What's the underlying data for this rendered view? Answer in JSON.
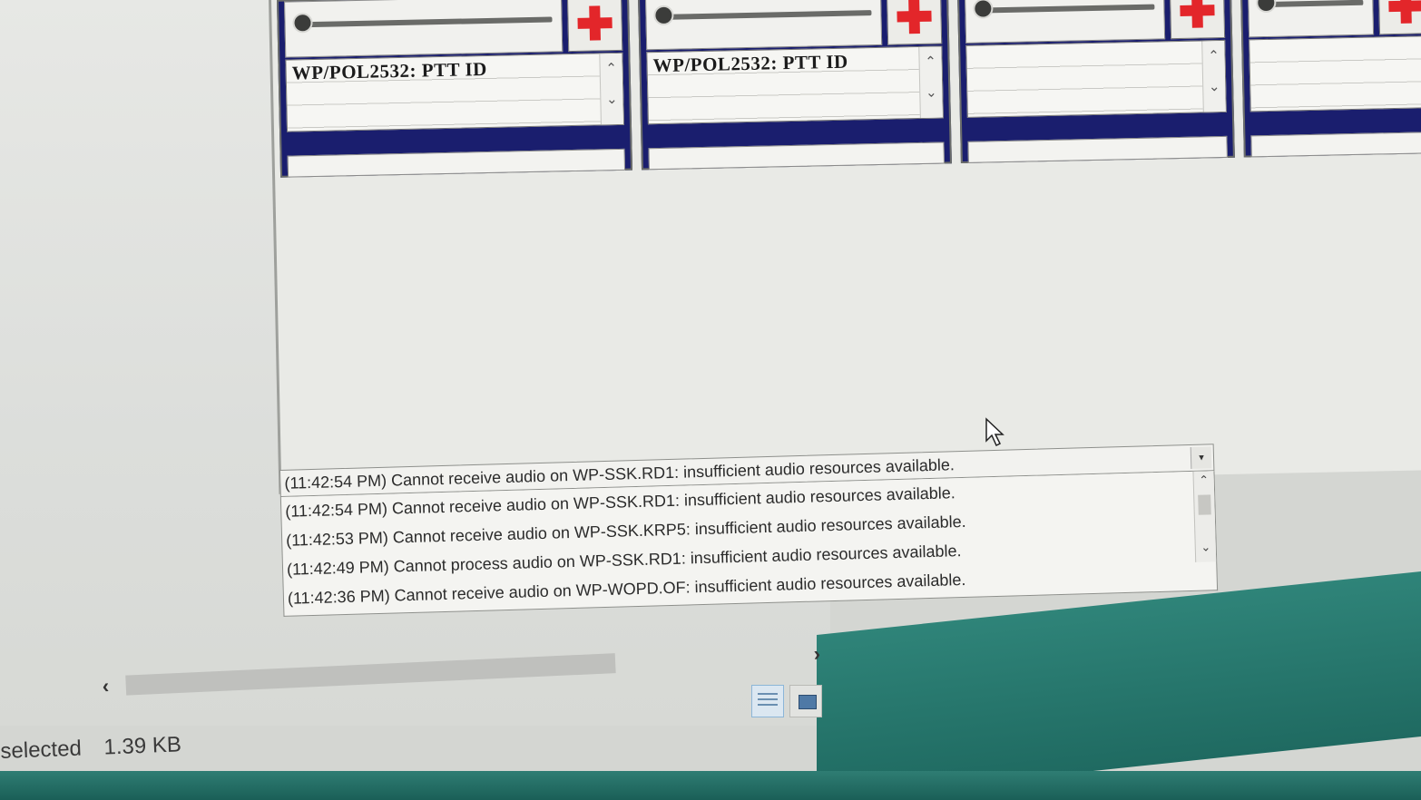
{
  "channel_panels": [
    {
      "id_label": "WP/POL2532: PTT ID"
    },
    {
      "id_label": "WP/POL2532: PTT ID"
    },
    {
      "id_label": ""
    },
    {
      "id_label": ""
    }
  ],
  "event_log": {
    "current": "(11:42:54 PM) Cannot receive audio on WP-SSK.RD1:  insufficient audio resources available.",
    "entries": [
      "(11:42:54 PM) Cannot receive audio on WP-SSK.RD1:  insufficient audio resources available.",
      "(11:42:53 PM) Cannot receive audio on WP-SSK.KRP5:  insufficient audio resources available.",
      "(11:42:49 PM) Cannot process audio on WP-SSK.RD1: insufficient audio resources available.",
      "(11:42:36 PM) Cannot receive audio on WP-WOPD.OF:  insufficient audio resources available."
    ]
  },
  "explorer_status": {
    "selected_text": "selected",
    "size_text": "1.39 KB"
  },
  "icons": {
    "mute": "red-cross-icon",
    "volume": "slider-knob-icon",
    "cursor": "mouse-pointer-icon"
  },
  "colors": {
    "panel_border": "#1a1e6e",
    "cross_red": "#e3262a",
    "taskbar_teal": "#2f8479"
  }
}
